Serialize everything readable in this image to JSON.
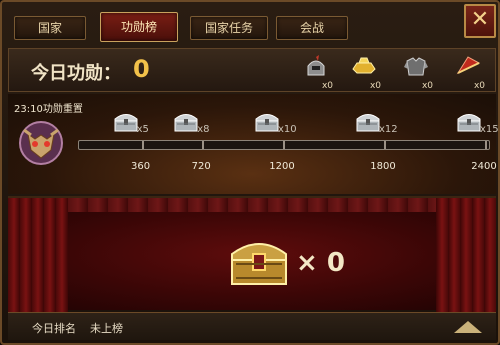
{
  "tabs": [
    {
      "label": "国家",
      "active": false
    },
    {
      "label": "功勋榜",
      "active": true
    },
    {
      "label": "国家任务",
      "active": false
    },
    {
      "label": "会战",
      "active": false
    }
  ],
  "close": {
    "icon": "close-icon",
    "glyph": "✕"
  },
  "header": {
    "today_label": "今日功勋：",
    "today_value": "0",
    "rewards": [
      {
        "icon": "helmet-icon",
        "count": "x0"
      },
      {
        "icon": "gold-ingot-icon",
        "count": "x0"
      },
      {
        "icon": "armor-icon",
        "count": "x0"
      },
      {
        "icon": "red-fan-icon",
        "count": "x0"
      }
    ]
  },
  "progress": {
    "reset_text": "23:10功勋重置",
    "current": 0,
    "max": 2400,
    "milestones": [
      {
        "threshold": "360",
        "value": 360,
        "multiplier": "x5"
      },
      {
        "threshold": "720",
        "value": 720,
        "multiplier": "x8"
      },
      {
        "threshold": "1200",
        "value": 1200,
        "multiplier": "x10"
      },
      {
        "threshold": "1800",
        "value": 1800,
        "multiplier": "x12"
      },
      {
        "threshold": "2400",
        "value": 2400,
        "multiplier": "x15"
      }
    ]
  },
  "stage": {
    "chest_multiplier": "× 0"
  },
  "footer": {
    "rank_label": "今日排名",
    "rank_value": "未上榜"
  },
  "colors": {
    "accent_gold": "#f2c14a",
    "active_tab": "#7a1e14",
    "curtain": "#5e0c0c"
  }
}
